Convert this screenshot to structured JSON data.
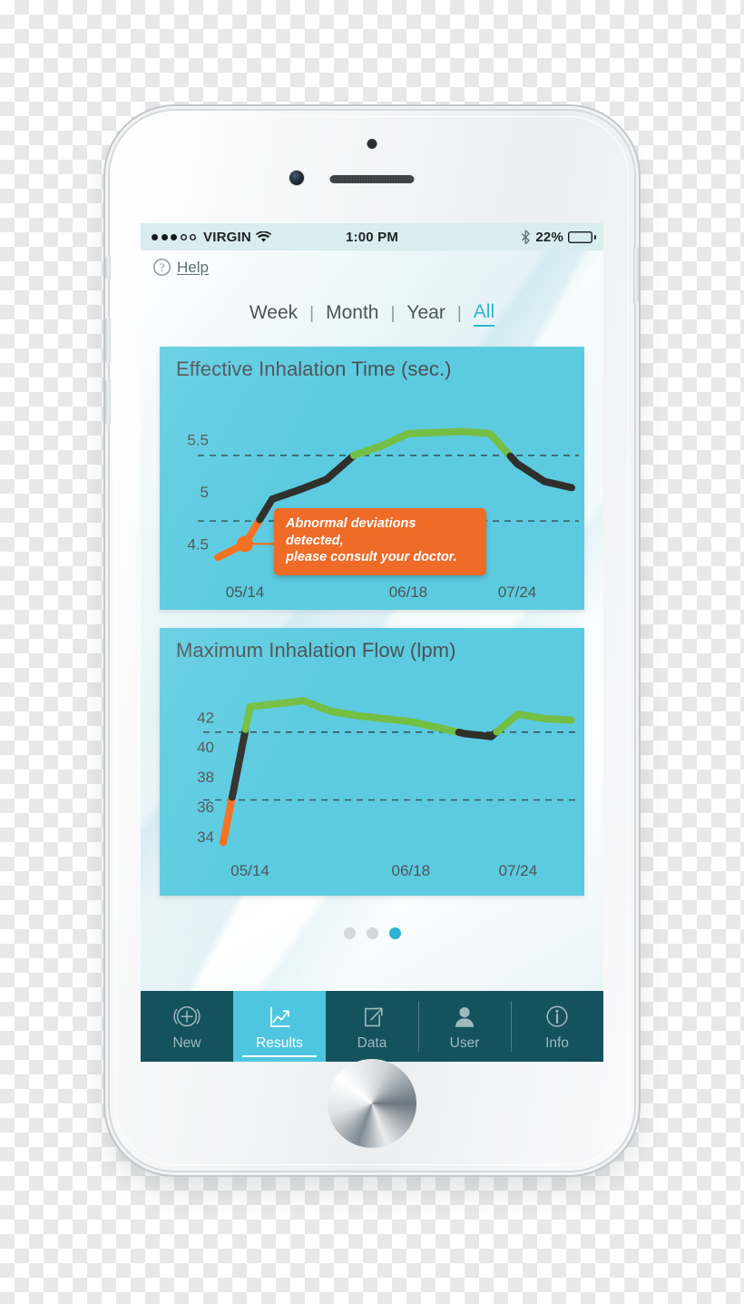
{
  "status_bar": {
    "carrier": "VIRGIN",
    "signal_filled": 3,
    "signal_empty": 2,
    "wifi_icon": "wifi-icon",
    "time": "1:00 PM",
    "bluetooth_icon": "bluetooth-icon",
    "battery_percent": "22%",
    "battery_level": 22
  },
  "help": {
    "icon": "question-mark-icon",
    "label": "Help"
  },
  "range_tabs": {
    "separator": "|",
    "items": [
      {
        "label": "Week",
        "active": false
      },
      {
        "label": "Month",
        "active": false
      },
      {
        "label": "Year",
        "active": false
      },
      {
        "label": "All",
        "active": true
      }
    ]
  },
  "callout": {
    "line1": "Abnormal deviations detected,",
    "line2": "please consult your doctor.",
    "color": "#ee6b28"
  },
  "page_dots": {
    "count": 3,
    "active_index": 2,
    "active_color": "#2bb3cf",
    "inactive_color": "#d2d6d8"
  },
  "tab_bar": {
    "background": "#14525e",
    "active_background": "#4ec6df",
    "items": [
      {
        "label": "New",
        "icon": "add-circle-icon",
        "active": false
      },
      {
        "label": "Results",
        "icon": "line-chart-icon",
        "active": true
      },
      {
        "label": "Data",
        "icon": "share-export-icon",
        "active": false
      },
      {
        "label": "User",
        "icon": "person-icon",
        "active": false
      },
      {
        "label": "Info",
        "icon": "info-circle-icon",
        "active": false
      }
    ]
  },
  "colors": {
    "chart_background": "#5ccbe0",
    "line_green": "#74be43",
    "line_black": "#2f2f2c",
    "line_orange": "#f4701f",
    "accent_teal": "#30b5cf",
    "text_dark": "#4d5458"
  },
  "chart_data": [
    {
      "type": "line",
      "title": "Effective Inhalation Time (sec.)",
      "xlabel": "",
      "ylabel": "sec.",
      "ylim": [
        4.25,
        5.75
      ],
      "yticks": [
        "5.5",
        "5",
        "4.5"
      ],
      "ytick_values": [
        5.5,
        5.0,
        4.5
      ],
      "xticks": [
        "05/14",
        "06/18",
        "07/24"
      ],
      "grid": false,
      "reference_lines": [
        5.35,
        4.72
      ],
      "marker": {
        "x_index": 1,
        "value": 4.5,
        "color": "#f4701f",
        "label": "abnormal-point"
      },
      "legend": "",
      "series": [
        {
          "name": "Effective Inhalation Time",
          "segment_colors": {
            "below_low": "#f4701f",
            "mid": "#2f2f2c",
            "above_high": "#74be43"
          },
          "x": [
            "",
            "05/14",
            "",
            "",
            "",
            "",
            "",
            "06/18",
            "",
            "",
            "",
            "07/24",
            "",
            ""
          ],
          "values": [
            4.37,
            4.5,
            4.93,
            5.02,
            5.12,
            5.35,
            5.44,
            5.56,
            5.57,
            5.58,
            5.56,
            5.27,
            5.1,
            5.04
          ]
        }
      ]
    },
    {
      "type": "line",
      "title": "Maximum Inhalation Flow (lpm)",
      "xlabel": "",
      "ylabel": "lpm",
      "ylim": [
        33.2,
        43.6
      ],
      "yticks": [
        "42",
        "40",
        "38",
        "36",
        "34"
      ],
      "ytick_values": [
        42,
        40,
        38,
        36,
        34
      ],
      "xticks": [
        "05/14",
        "06/18",
        "07/24"
      ],
      "grid": false,
      "reference_lines": [
        41.0,
        36.45
      ],
      "legend": "",
      "series": [
        {
          "name": "Maximum Inhalation Flow",
          "segment_colors": {
            "below_low": "#f4701f",
            "mid": "#2f2f2c",
            "above_high": "#74be43"
          },
          "x": [
            "",
            "05/14",
            "",
            "",
            "",
            "",
            "",
            "06/18",
            "",
            "",
            "",
            "07/24",
            "",
            ""
          ],
          "values": [
            33.6,
            42.7,
            42.9,
            43.1,
            42.4,
            42.1,
            41.9,
            41.7,
            41.3,
            40.9,
            40.7,
            42.2,
            41.9,
            41.8
          ]
        }
      ]
    }
  ]
}
